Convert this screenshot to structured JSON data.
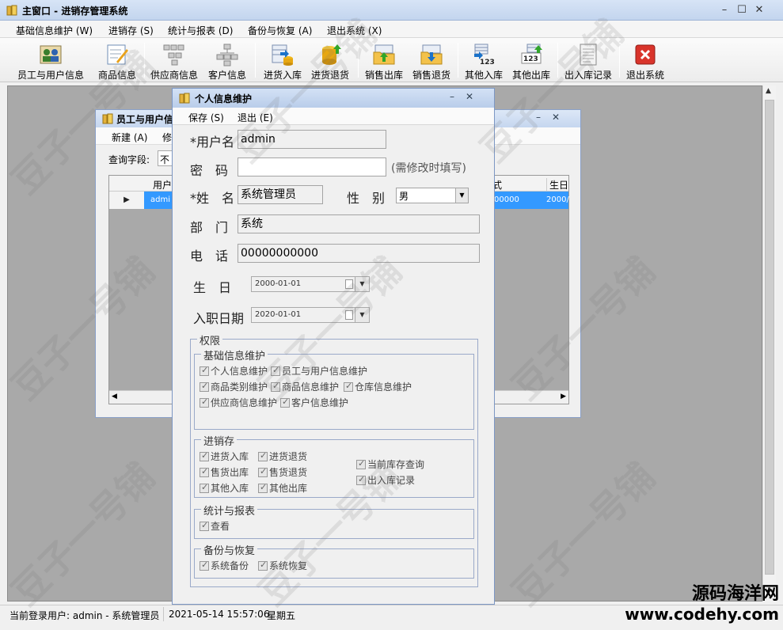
{
  "window": {
    "title": "主窗口 - 进销存管理系统",
    "min": "–",
    "max": "☐",
    "close": "✕"
  },
  "menu": [
    "基础信息维护 (W)",
    "进销存 (S)",
    "统计与报表 (D)",
    "备份与恢复 (A)",
    "退出系统 (X)"
  ],
  "toolbar": [
    {
      "label": "员工与用户信息",
      "icon": "users-icon"
    },
    {
      "label": "商品信息",
      "icon": "edit-icon"
    },
    {
      "label": "供应商信息",
      "icon": "org-icon"
    },
    {
      "label": "客户信息",
      "icon": "org-icon"
    },
    {
      "label": "进货入库",
      "icon": "db-in-icon"
    },
    {
      "label": "进货退货",
      "icon": "db-out-icon"
    },
    {
      "label": "销售出库",
      "icon": "folder-out-icon"
    },
    {
      "label": "销售退货",
      "icon": "folder-in-icon"
    },
    {
      "label": "其他入库",
      "icon": "num-in-icon"
    },
    {
      "label": "其他出库",
      "icon": "num-out-icon"
    },
    {
      "label": "出入库记录",
      "icon": "log-icon"
    },
    {
      "label": "退出系统",
      "icon": "exit-icon"
    }
  ],
  "child": {
    "title": "员工与用户信",
    "menu": [
      "新建 (A)",
      "修"
    ],
    "query_label": "查询字段:",
    "query_value": "不",
    "grid_headers": [
      "用户",
      "式",
      "生日"
    ],
    "grid_row": [
      "admi",
      "00000",
      "2000/"
    ]
  },
  "dialog": {
    "title": "个人信息维护",
    "menu": [
      "保存 (S)",
      "退出 (E)"
    ],
    "username_label": "*用户名",
    "username": "admin",
    "password_label": "密　码",
    "password_hint": "(需修改时填写)",
    "name_label": "*姓　名",
    "name": "系统管理员",
    "gender_label": "性　别",
    "gender": "男",
    "dept_label": "部　门",
    "dept": "系统",
    "phone_label": "电　话",
    "phone": "00000000000",
    "birthday_label": "生　日",
    "birthday": "2000-01-01",
    "hire_label": "入职日期",
    "hire_date": "2020-01-01",
    "perm_title": "权限",
    "groups": {
      "basic": {
        "title": "基础信息维护",
        "items": [
          "个人信息维护",
          "员工与用户信息维护",
          "商品类别维护",
          "商品信息维护",
          "仓库信息维护",
          "供应商信息维护",
          "客户信息维护"
        ]
      },
      "stock": {
        "title": "进销存",
        "items": [
          "进货入库",
          "进货退货",
          "售货出库",
          "售货退货",
          "其他入库",
          "其他出库",
          "当前库存查询",
          "出入库记录"
        ]
      },
      "report": {
        "title": "统计与报表",
        "items": [
          "查看"
        ]
      },
      "backup": {
        "title": "备份与恢复",
        "items": [
          "系统备份",
          "系统恢复"
        ]
      }
    }
  },
  "status": {
    "user": "当前登录用户: admin - 系统管理员",
    "datetime": "2021-05-14 15:57:06",
    "weekday": "星期五"
  },
  "watermark": "豆子一号铺",
  "site": {
    "cn": "源码海洋网",
    "url": "www.codehy.com"
  },
  "colors": {
    "title_bar": "#c3d5ee",
    "mdi_bg": "#a9a9a9",
    "selection": "#3399ff",
    "exit_red": "#d9342b"
  }
}
